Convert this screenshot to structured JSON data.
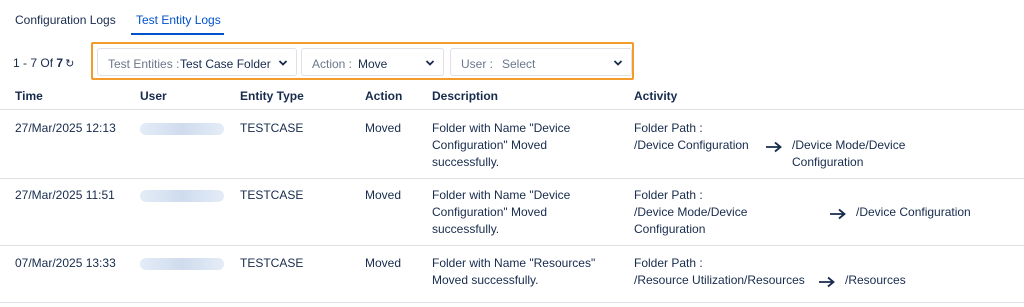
{
  "tabs": [
    {
      "label": "Configuration Logs",
      "active": false
    },
    {
      "label": "Test Entity Logs",
      "active": true
    }
  ],
  "pagination": {
    "range": "1 - 7",
    "of_label": "Of",
    "total": "7"
  },
  "filters": {
    "test_entities": {
      "label": "Test Entities :",
      "value": "Test Case Folder"
    },
    "action": {
      "label": "Action :",
      "value": "Move"
    },
    "user": {
      "label": "User :",
      "placeholder": "Select"
    }
  },
  "table": {
    "columns": [
      "Time",
      "User",
      "Entity Type",
      "Action",
      "Description",
      "Activity"
    ],
    "rows": [
      {
        "time": "27/Mar/2025 12:13",
        "entity_type": "TESTCASE",
        "action": "Moved",
        "description": [
          "Folder with Name \"Device",
          "Configuration\" Moved",
          "successfully."
        ],
        "activity_label": "Folder Path :",
        "from": [
          "/Device Configuration"
        ],
        "to": [
          "/Device Mode/Device",
          "Configuration"
        ]
      },
      {
        "time": "27/Mar/2025 11:51",
        "entity_type": "TESTCASE",
        "action": "Moved",
        "description": [
          "Folder with Name \"Device",
          "Configuration\" Moved",
          "successfully."
        ],
        "activity_label": "Folder Path :",
        "from": [
          "/Device Mode/Device",
          "Configuration"
        ],
        "to": [
          "/Device Configuration"
        ]
      },
      {
        "time": "07/Mar/2025 13:33",
        "entity_type": "TESTCASE",
        "action": "Moved",
        "description": [
          "Folder with Name \"Resources\"",
          "Moved successfully."
        ],
        "activity_label": "Folder Path :",
        "from": [
          "/Resource Utilization/Resources"
        ],
        "to": [
          "/Resources"
        ]
      }
    ]
  },
  "colors": {
    "accent": "#0052cc",
    "highlight_border": "#f39c2c",
    "text": "#172b4d"
  },
  "icons": [
    "refresh-icon",
    "chevron-down-icon",
    "arrow-right-icon"
  ]
}
